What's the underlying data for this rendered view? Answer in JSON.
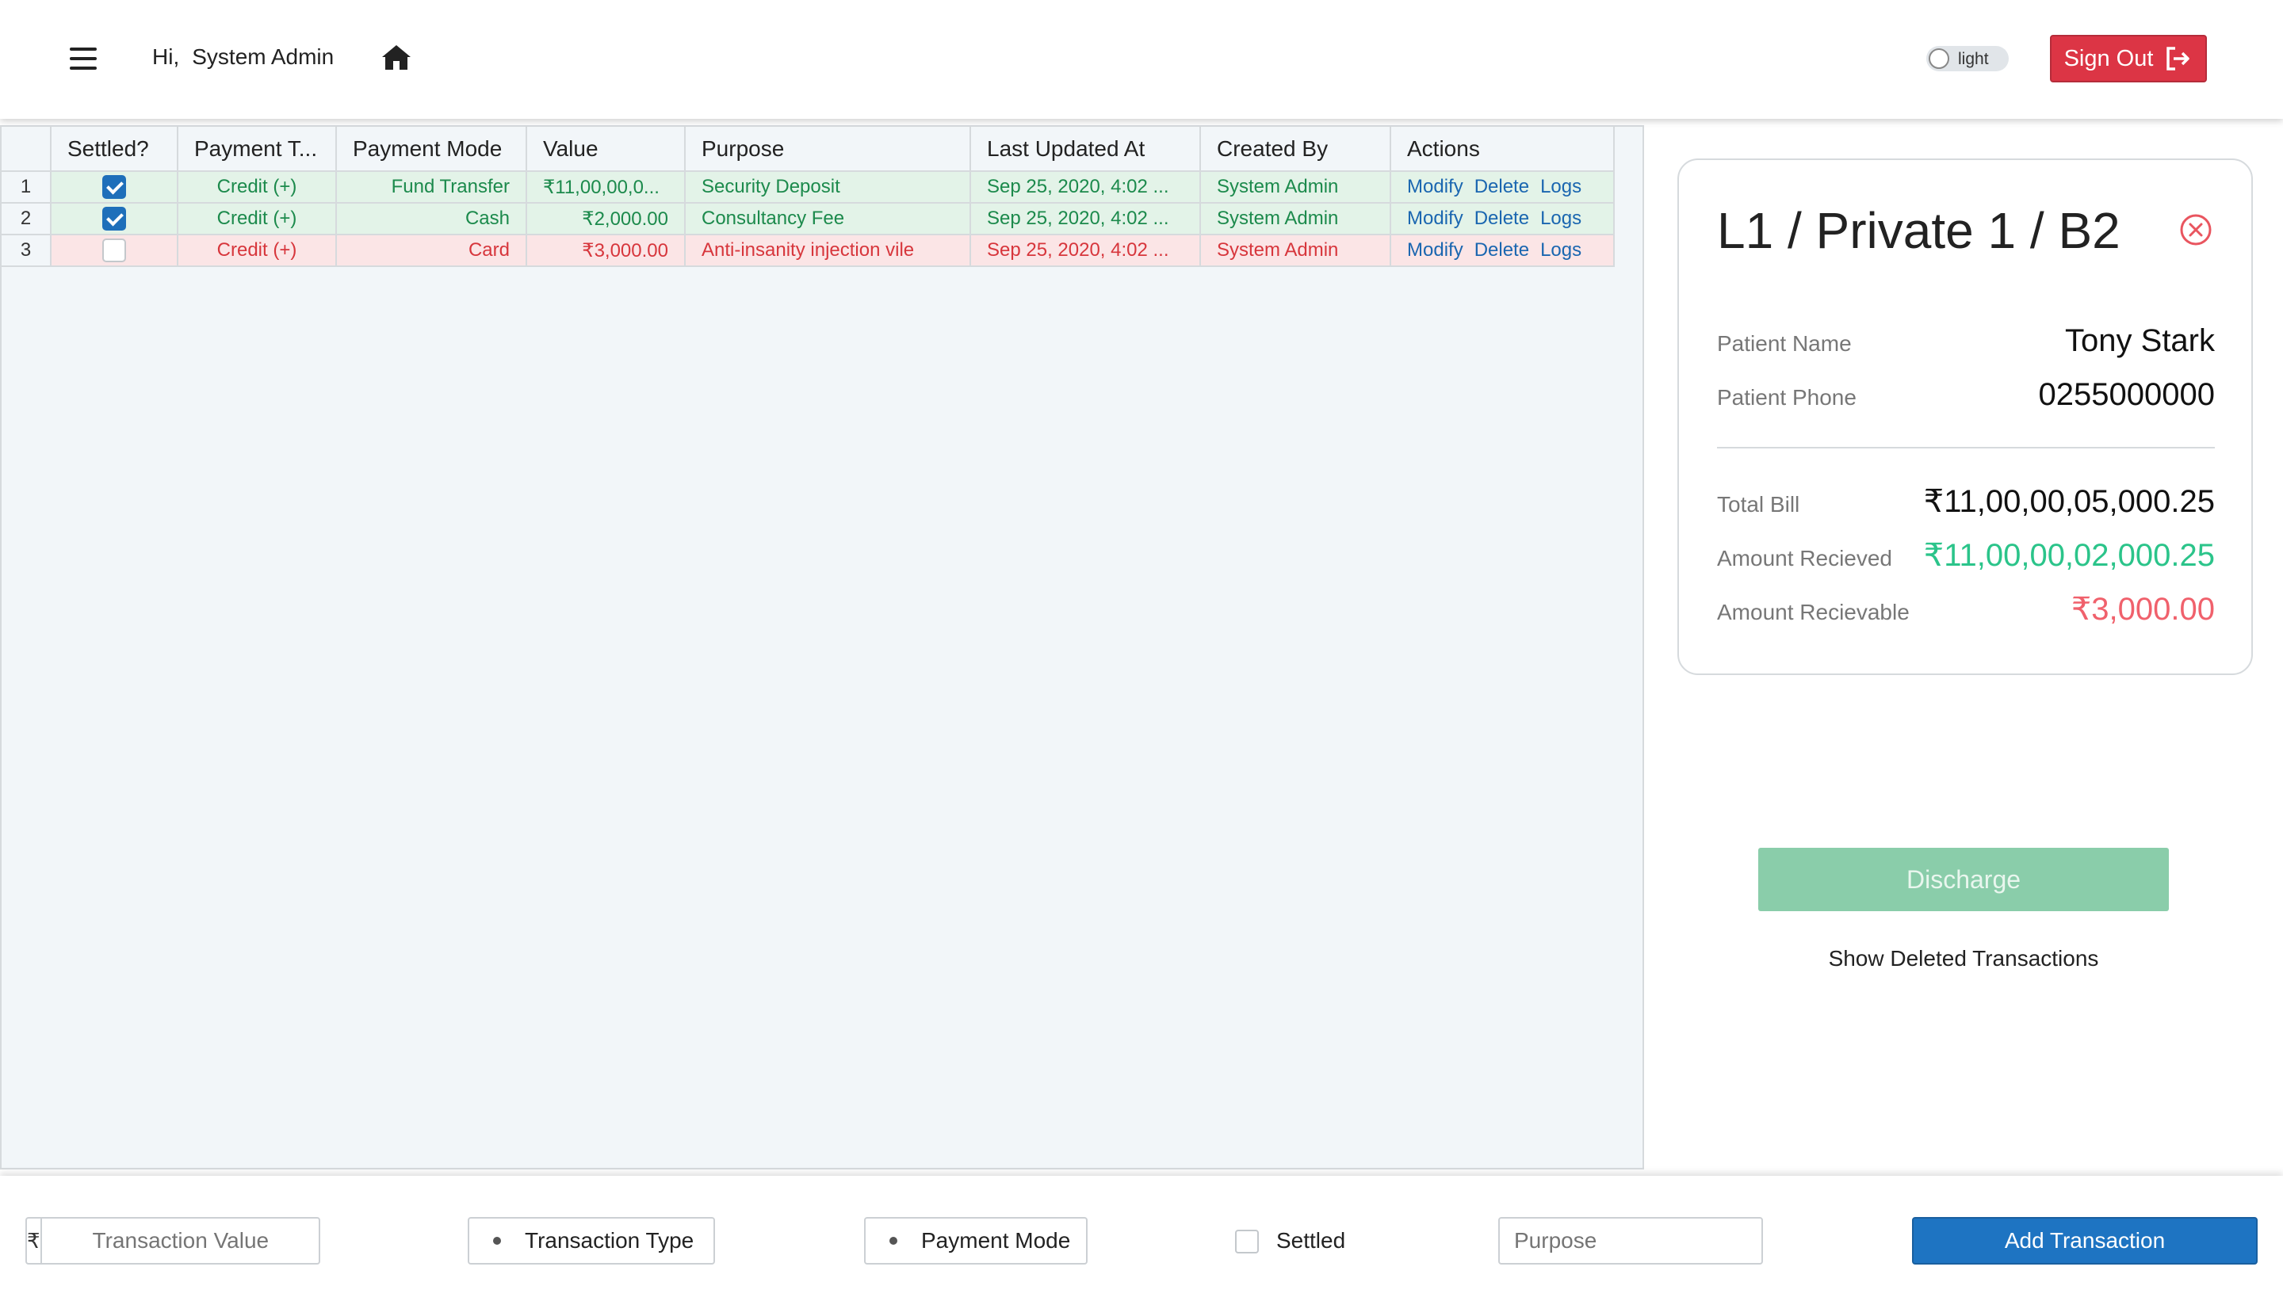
{
  "header": {
    "greeting": "Hi,",
    "user_name": "System Admin",
    "theme_toggle_label": "light",
    "sign_out_label": "Sign Out"
  },
  "grid": {
    "columns": [
      "Settled?",
      "Payment T...",
      "Payment Mode",
      "Value",
      "Purpose",
      "Last Updated At",
      "Created By",
      "Actions"
    ],
    "rows": [
      {
        "num": "1",
        "settled": true,
        "payment_type": "Credit (+)",
        "payment_mode": "Fund Transfer",
        "value": "₹11,00,00,0...",
        "purpose": "Security Deposit",
        "last_updated": "Sep 25, 2020, 4:02 ...",
        "created_by": "System Admin"
      },
      {
        "num": "2",
        "settled": true,
        "payment_type": "Credit (+)",
        "payment_mode": "Cash",
        "value": "₹2,000.00",
        "purpose": "Consultancy Fee",
        "last_updated": "Sep 25, 2020, 4:02 ...",
        "created_by": "System Admin"
      },
      {
        "num": "3",
        "settled": false,
        "payment_type": "Credit (+)",
        "payment_mode": "Card",
        "value": "₹3,000.00",
        "purpose": "Anti-insanity injection vile",
        "last_updated": "Sep 25, 2020, 4:02 ...",
        "created_by": "System Admin"
      }
    ],
    "actions": {
      "modify": "Modify",
      "delete": "Delete",
      "logs": "Logs"
    }
  },
  "card": {
    "title": "L1 / Private 1 / B2",
    "patient_name_label": "Patient Name",
    "patient_name": "Tony Stark",
    "patient_phone_label": "Patient Phone",
    "patient_phone": "0255000000",
    "total_bill_label": "Total Bill",
    "total_bill": "₹11,00,00,05,000.25",
    "amount_received_label": "Amount Recieved",
    "amount_received": "₹11,00,00,02,000.25",
    "amount_receivable_label": "Amount Recievable",
    "amount_receivable": "₹3,000.00"
  },
  "discharge_label": "Discharge",
  "show_deleted_label": "Show Deleted Transactions",
  "footer": {
    "currency_symbol": "₹",
    "value_placeholder": "Transaction Value",
    "transaction_type_label": "Transaction Type",
    "payment_mode_label": "Payment Mode",
    "settled_label": "Settled",
    "purpose_placeholder": "Purpose",
    "add_button_label": "Add Transaction"
  },
  "colors": {
    "settled_row_bg": "#e3f3e8",
    "settled_row_text": "#1c8a4c",
    "unsettled_row_bg": "#fbe5e6",
    "unsettled_row_text": "#d7363c",
    "sign_out_bg": "#dc3545",
    "add_button_bg": "#1e74c2",
    "discharge_bg": "#8acdaa",
    "received_amount": "#2bc48a",
    "receivable_amount": "#f0616c"
  },
  "icons": {
    "menu": "hamburger-icon",
    "home": "home-icon",
    "sign_out": "sign-out-icon",
    "close": "close-circle-icon"
  }
}
